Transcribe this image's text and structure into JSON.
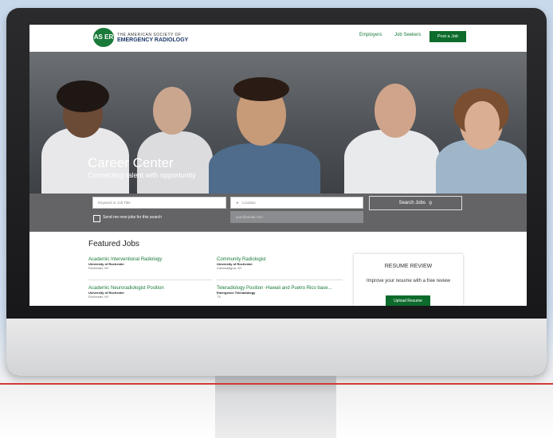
{
  "logo": {
    "badge": "AS ER",
    "line1": "THE AMERICAN SOCIETY OF",
    "line2": "EMERGENCY RADIOLOGY"
  },
  "nav": {
    "employers": "Employers",
    "job_seekers": "Job Seekers",
    "post_job": "Post a Job"
  },
  "hero": {
    "title": "Career Center",
    "subtitle": "Connecting talent with opportunity"
  },
  "search": {
    "keyword_placeholder": "Keyword or Job Title",
    "location_placeholder": "Location",
    "email_placeholder": "your@email.com",
    "checkbox_label": "Send me new jobs for this search",
    "button_label": "Search Jobs"
  },
  "featured": {
    "title": "Featured Jobs",
    "jobs": [
      {
        "title": "Academic Interventional Radiology",
        "company": "University of Rochester",
        "location": "Rochester, NY"
      },
      {
        "title": "Community Radiologist",
        "company": "University of Rochester",
        "location": "Canandaigua, NY"
      },
      {
        "title": "Academic Neuroradiologist Position",
        "company": "University of Rochester",
        "location": "Rochester, NY"
      },
      {
        "title": "Teleradiology Position -Hawaii and Puetro Rico base...",
        "company": "Emergence Teleradiology",
        "location": "TX"
      }
    ]
  },
  "resume": {
    "title": "RESUME REVIEW",
    "text": "Improve your resume with a free review",
    "button": "Upload Resume"
  },
  "colors": {
    "brand_green": "#0d6b2c",
    "link_green": "#1a7a3a",
    "accent_red": "#d33a36"
  }
}
